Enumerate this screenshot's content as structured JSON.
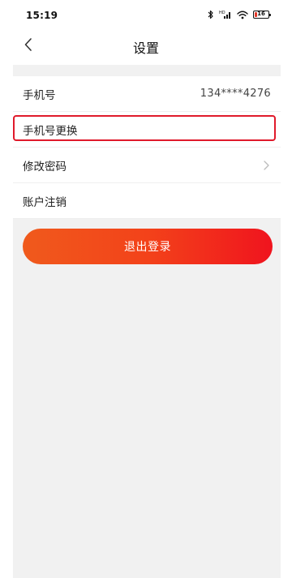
{
  "status_bar": {
    "time": "15:19",
    "battery_level": "16",
    "icons": [
      "bluetooth-icon",
      "signal-icon",
      "wifi-icon",
      "battery-icon"
    ]
  },
  "header": {
    "title": "设置",
    "back_icon": "chevron-left-icon"
  },
  "settings": {
    "phone": {
      "label": "手机号",
      "value": "134****4276"
    },
    "change_phone": {
      "label": "手机号更换"
    },
    "change_password": {
      "label": "修改密码",
      "icon": "chevron-right-icon"
    },
    "cancel_account": {
      "label": "账户注销"
    }
  },
  "logout": {
    "label": "退出登录"
  },
  "colors": {
    "accent_start": "#f05a1c",
    "accent_end": "#f0141e",
    "highlight_border": "#e01a2b",
    "background_gray": "#f1f1f1"
  }
}
